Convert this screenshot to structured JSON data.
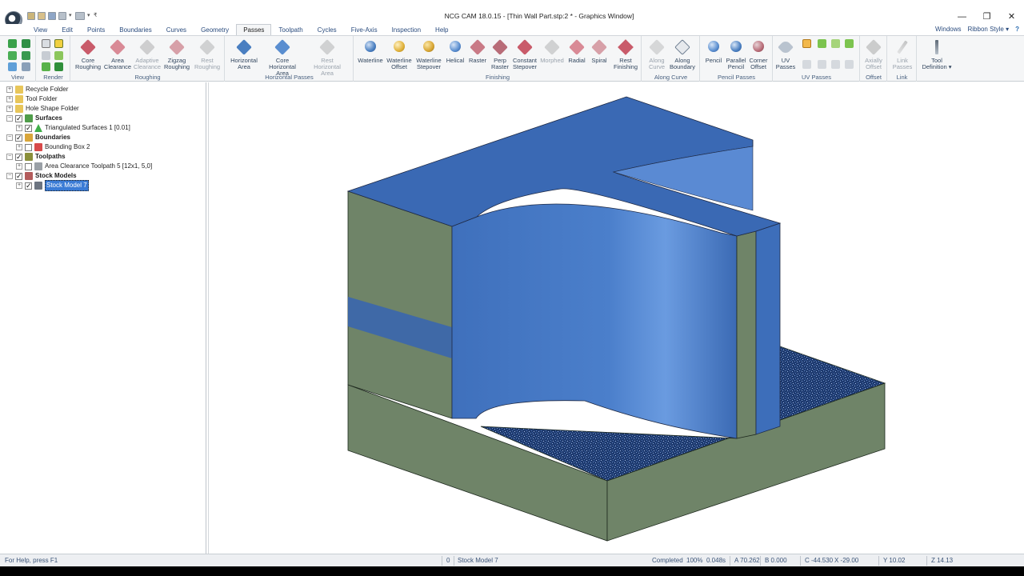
{
  "window": {
    "title": "NCG CAM 18.0.15 - [Thin Wall Part.stp:2 * - Graphics Window]",
    "minimize": "—",
    "restore": "❐",
    "close": "✕"
  },
  "menu": {
    "tabs": [
      "View",
      "Edit",
      "Points",
      "Boundaries",
      "Curves",
      "Geometry",
      "Passes",
      "Toolpath",
      "Cycles",
      "Five-Axis",
      "Inspection",
      "Help"
    ],
    "active_tab": "Passes",
    "windows": "Windows",
    "ribbon_style": "Ribbon Style",
    "style_arrow": "▾",
    "help_icon": "?"
  },
  "ribbon": {
    "groups": {
      "view": "View",
      "render": "Render",
      "roughing": "Roughing",
      "horizontal_passes": "Horizontal Passes",
      "finishing": "Finishing",
      "along_curve": "Along Curve",
      "pencil_passes": "Pencil Passes",
      "uv_passes": "UV Passes",
      "offset": "Offset",
      "link": "Link"
    },
    "buttons": {
      "core_roughing": "Core\nRoughing",
      "area_clearance": "Area\nClearance",
      "adaptive_clearance": "Adaptive\nClearance",
      "zigzag_roughing": "Zigzag\nRoughing",
      "rest_roughing": "Rest\nRoughing",
      "horizontal_area": "Horizontal\nArea",
      "core_horizontal_area": "Core\nHorizontal Area",
      "rest_horizontal_area": "Rest Horizontal\nArea",
      "waterline": "Waterline",
      "waterline_offset": "Waterline\nOffset",
      "waterline_stepover": "Waterline\nStepover",
      "helical": "Helical",
      "raster": "Raster",
      "perp_raster": "Perp\nRaster",
      "constant_stepover": "Constant\nStepover",
      "morphed": "Morphed",
      "radial": "Radial",
      "spiral": "Spiral",
      "rest_finishing": "Rest\nFinishing",
      "along_curve": "Along\nCurve",
      "along_boundary": "Along\nBoundary",
      "pencil": "Pencil",
      "parallel_pencil": "Parallel\nPencil",
      "corner_offset": "Corner\nOffset",
      "uv_passes": "UV\nPasses",
      "axially_offset": "Axially\nOffset",
      "link_passes": "Link\nPasses",
      "tool_definition": "Tool\nDefinition ▾"
    },
    "colors": {
      "roughing": "#c95b6a",
      "clearance": "#d98a96",
      "blue_op": "#4a7fc1",
      "gold_op": "#e0b13a",
      "disabled": "#b8bec6"
    }
  },
  "tree": {
    "items": [
      {
        "label": "Recycle Folder",
        "bold": false,
        "expander": "+",
        "check": "none",
        "icon": "folder-icon",
        "icon_color": "#e8c65a",
        "selected": false
      },
      {
        "label": "Tool Folder",
        "bold": false,
        "expander": "+",
        "check": "none",
        "icon": "folder-icon",
        "icon_color": "#e8c65a",
        "selected": false
      },
      {
        "label": "Hole Shape Folder",
        "bold": false,
        "expander": "+",
        "check": "none",
        "icon": "folder-icon",
        "icon_color": "#e8c65a",
        "selected": false
      },
      {
        "label": "Surfaces",
        "bold": true,
        "expander": "−",
        "check": "checked",
        "icon": "surfaces-icon",
        "icon_color": "#4f9d4a",
        "selected": false
      },
      {
        "label": "Triangulated Surfaces 1 [0.01]",
        "bold": false,
        "expander": "+",
        "check": "checked",
        "icon": "triangle-icon",
        "icon_color": "#3fae49",
        "selected": false
      },
      {
        "label": "Boundaries",
        "bold": true,
        "expander": "−",
        "check": "checked",
        "icon": "boundaries-icon",
        "icon_color": "#d9a63a",
        "selected": false
      },
      {
        "label": "Bounding Box 2",
        "bold": false,
        "expander": "+",
        "check": "unchecked",
        "icon": "box-icon",
        "icon_color": "#d84a4a",
        "selected": false
      },
      {
        "label": "Toolpaths",
        "bold": true,
        "expander": "−",
        "check": "checked",
        "icon": "toolpaths-icon",
        "icon_color": "#8a8f3a",
        "selected": false
      },
      {
        "label": "Area Clearance Toolpath 5 [12x1, 5,0]",
        "bold": false,
        "expander": "+",
        "check": "unchecked",
        "icon": "toolpath-icon",
        "icon_color": "#9aa0a6",
        "selected": false
      },
      {
        "label": "Stock Models",
        "bold": true,
        "expander": "−",
        "check": "checked",
        "icon": "stock-models-icon",
        "icon_color": "#b35c5c",
        "selected": false
      },
      {
        "label": "Stock Model 7",
        "bold": false,
        "expander": "+",
        "check": "checked",
        "icon": "stock-model-icon",
        "icon_color": "#6c7480",
        "selected": true
      }
    ]
  },
  "viewport": {
    "background": "#ffffff",
    "part_top_color": "#3a69b4",
    "part_face_color": "#4173bd",
    "stock_side_color": "#6f8468",
    "stock_top_color": "#2b4f8c"
  },
  "status": {
    "help": "For Help, press F1",
    "code": "0",
    "object": "Stock Model 7",
    "completed": "Completed",
    "progress": "100%",
    "time": "0.048s",
    "a": "A 70.262",
    "b": "B 0.000",
    "c": "C -44.530",
    "x": "X -29.00",
    "y": "Y 10.02",
    "z": "Z 14.13"
  }
}
